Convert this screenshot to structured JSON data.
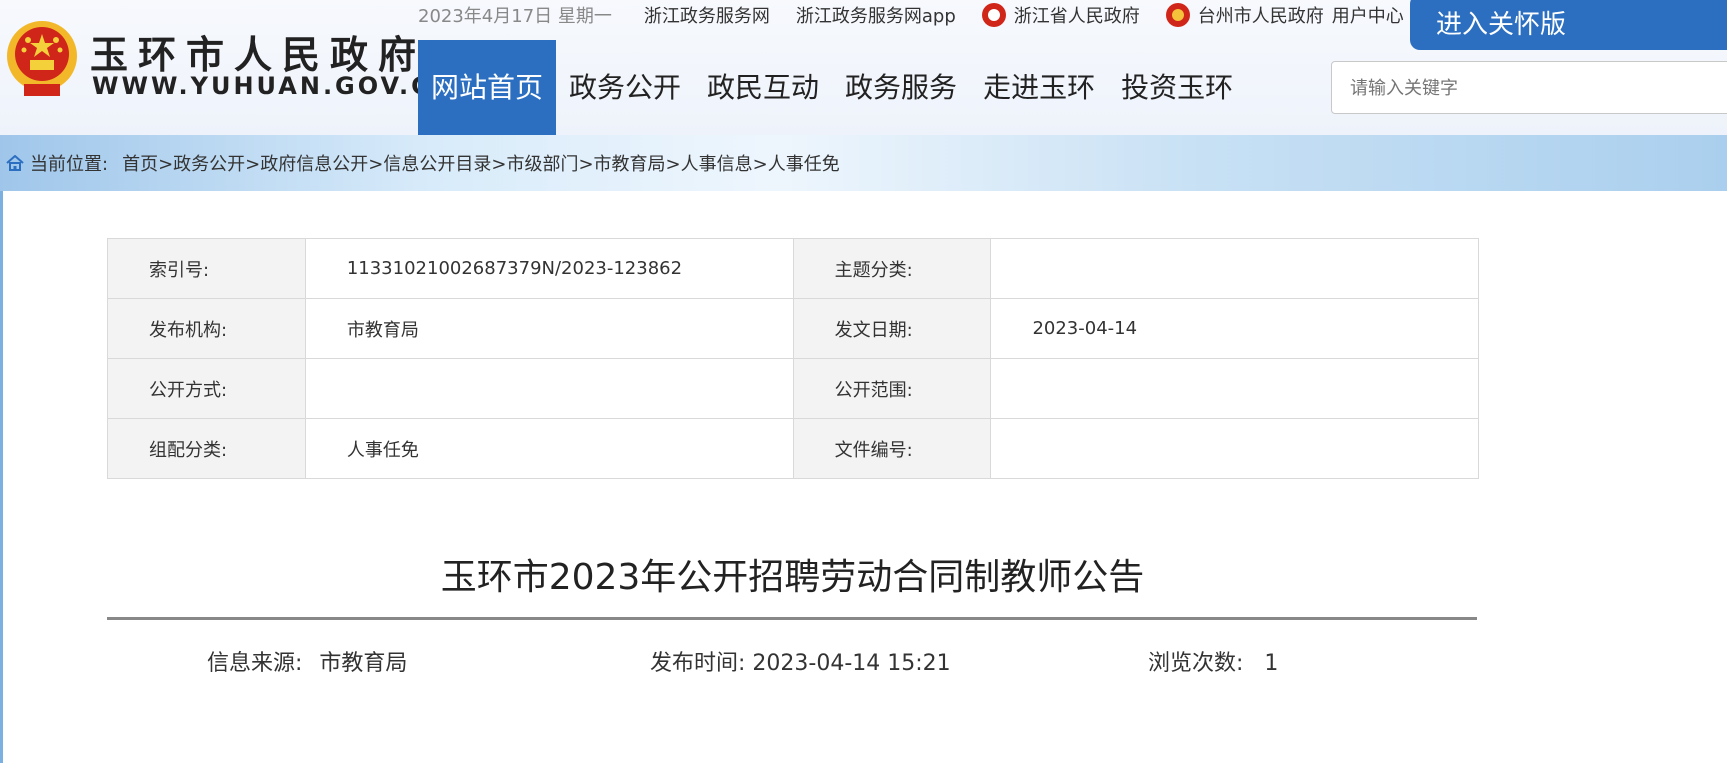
{
  "header": {
    "site_name": "玉环市人民政府",
    "site_url": "WWW.YUHUAN.GOV.CN",
    "date": "2023年4月17日 星期一",
    "links": [
      "浙江政务服务网",
      "浙江政务服务网app",
      "浙江省人民政府",
      "台州市人民政府",
      "用户中心"
    ],
    "care_button": "进入关怀版",
    "search_placeholder": "请输入关键字"
  },
  "nav": {
    "items": [
      "网站首页",
      "政务公开",
      "政民互动",
      "政务服务",
      "走进玉环",
      "投资玉环"
    ],
    "active": "网站首页"
  },
  "breadcrumb": {
    "label": "当前位置:",
    "items": [
      "首页>",
      "政务公开>",
      "政府信息公开>",
      "信息公开目录>",
      "市级部门>",
      "市教育局>",
      "人事信息>",
      "人事任免"
    ]
  },
  "meta_table": [
    {
      "k1": "索引号:",
      "v1": "11331021002687379N/2023-123862",
      "k2": "主题分类:",
      "v2": ""
    },
    {
      "k1": "发布机构:",
      "v1": "市教育局",
      "k2": "发文日期:",
      "v2": "2023-04-14"
    },
    {
      "k1": "公开方式:",
      "v1": "",
      "k2": "公开范围:",
      "v2": ""
    },
    {
      "k1": "组配分类:",
      "v1": "人事任免",
      "k2": "文件编号:",
      "v2": ""
    }
  ],
  "article": {
    "title": "玉环市2023年公开招聘劳动合同制教师公告",
    "source_label": "信息来源:",
    "source": "市教育局",
    "time_label": "发布时间:",
    "time": "2023-04-14 15:21",
    "views_label": "浏览次数:",
    "views": "1"
  },
  "colors": {
    "accent": "#2c6fc1",
    "emblem_red": "#d0261a",
    "emblem_gold": "#f4c23b"
  }
}
